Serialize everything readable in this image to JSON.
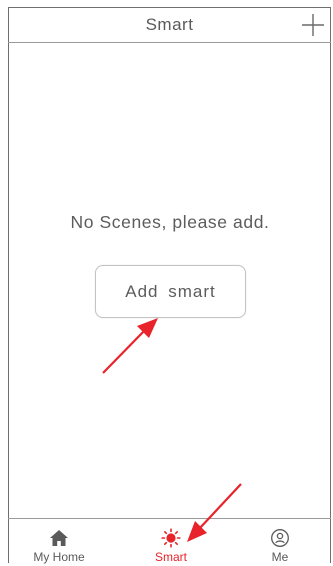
{
  "header": {
    "title": "Smart",
    "add_icon": "plus-icon"
  },
  "empty_state": {
    "message": "No Scenes, please add.",
    "button_label": "Add smart"
  },
  "tabbar": {
    "tabs": [
      {
        "label": "My Home",
        "icon": "home-icon",
        "active": false
      },
      {
        "label": "Smart",
        "icon": "sun-icon",
        "active": true
      },
      {
        "label": "Me",
        "icon": "user-icon",
        "active": false
      }
    ]
  },
  "colors": {
    "accent": "#e8232a",
    "text": "#5a5a5a",
    "border": "#9a9a9a"
  }
}
